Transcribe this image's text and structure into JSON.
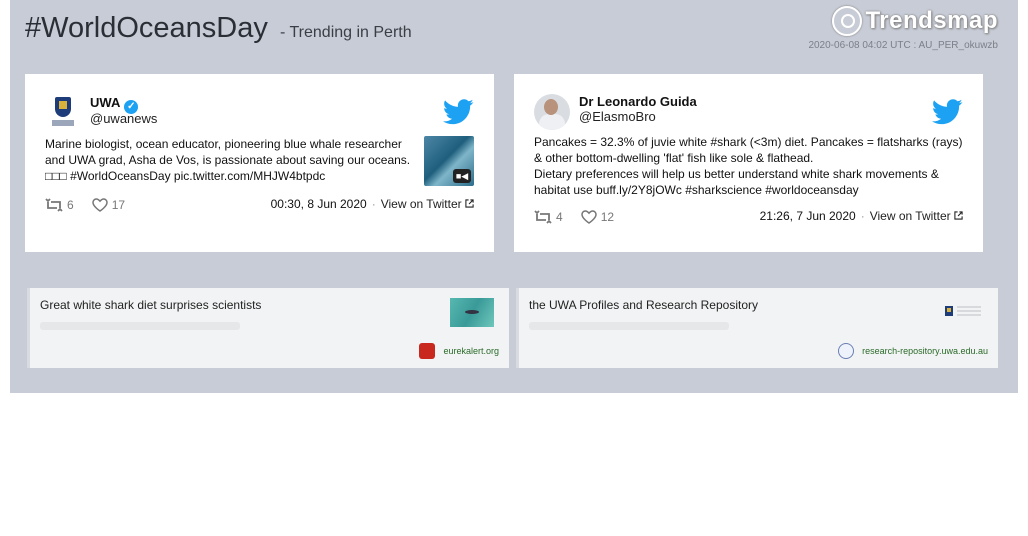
{
  "header": {
    "hashtag": "#WorldOceansDay",
    "subtitle": "- Trending in Perth",
    "brand": "Trendsmap",
    "meta": "2020-06-08 04:02 UTC : AU_PER_okuwzb"
  },
  "tweets": [
    {
      "name": "UWA",
      "verified": true,
      "handle": "@uwanews",
      "text_line1": "Marine biologist, ocean educator, pioneering blue whale researcher",
      "text_line2": "and UWA grad, Asha de Vos, is passionate about saving our oceans.",
      "text_line3": "□□□ #WorldOceansDay pic.twitter.com/MHJW4btpdc",
      "retweets": "6",
      "likes": "17",
      "timestamp": "00:30, 8 Jun 2020",
      "separator": "·",
      "view_label": "View on Twitter"
    },
    {
      "name": "Dr Leonardo Guida",
      "verified": false,
      "handle": "@ElasmoBro",
      "text_line1": "Pancakes = 32.3% of juvie white #shark (<3m) diet. Pancakes = flatsharks (rays)",
      "text_line2": "& other bottom-dwelling 'flat' fish like sole & flathead.",
      "text_line3": "Dietary preferences will help us better understand white shark movements &",
      "text_line4": "habitat use buff.ly/2Y8jOWc #sharkscience #worldoceansday",
      "retweets": "4",
      "likes": "12",
      "timestamp": "21:26, 7 Jun 2020",
      "separator": "·",
      "view_label": "View on Twitter"
    }
  ],
  "cards": [
    {
      "title": "Great white shark diet surprises scientists",
      "source": "eurekalert.org"
    },
    {
      "title": "the UWA Profiles and Research Repository",
      "source": "research-repository.uwa.edu.au"
    }
  ],
  "colors": {
    "panel": "#c8ccd6",
    "twitter_blue": "#1da1f2",
    "source_green": "#2a6b2a"
  }
}
